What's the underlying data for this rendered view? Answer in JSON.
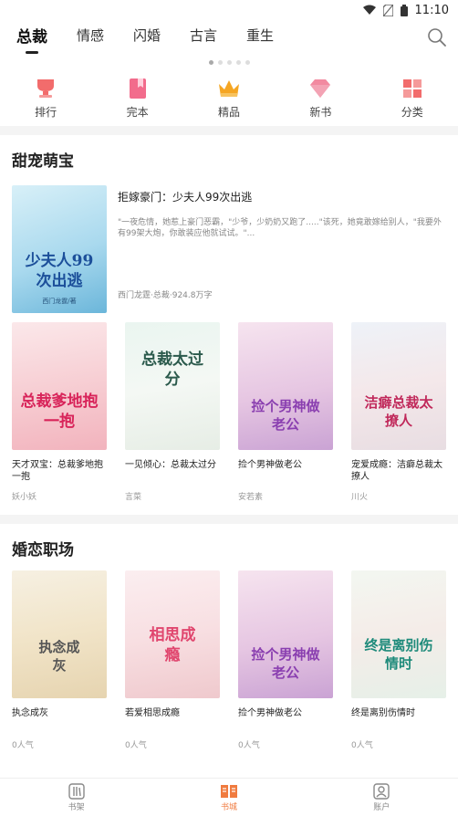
{
  "status_bar": {
    "time": "11:10"
  },
  "top_tabs": [
    "总裁",
    "情感",
    "闪婚",
    "古言",
    "重生"
  ],
  "categories": [
    "排行",
    "完本",
    "精品",
    "新书",
    "分类"
  ],
  "sections": [
    {
      "title": "甜宠萌宝",
      "featured": {
        "title": "拒嫁豪门：少夫人99次出逃",
        "description": "\"一夜危情，她惹上豪门恶霸，\"少爷，少奶奶又跑了.....\"该死，她竟敢嫁给别人，\"我要外有99架大炮，你敢装应他就试试。\"...",
        "meta": "西门龙霆·总裁·924.8万字",
        "cover_text": "少夫人99次出逃",
        "cover_author": "西门龙霆/著"
      },
      "books": [
        {
          "title": "天才双宝：总裁爹地抱一抱",
          "author": "妖小妖",
          "cover_text": "总裁爹地抱一抱"
        },
        {
          "title": "一见倾心：总裁太过分",
          "author": "言菜",
          "cover_text": "总裁太过分"
        },
        {
          "title": "捡个男神做老公",
          "author": "安若素",
          "cover_text": "捡个男神做老公"
        },
        {
          "title": "宠爱成瘾：洁癖总裁太撩人",
          "author": "川火",
          "cover_text": "洁癖总裁太撩人"
        }
      ]
    },
    {
      "title": "婚恋职场",
      "books": [
        {
          "title": "执念成灰",
          "author": "0人气",
          "cover_text": "执念成灰"
        },
        {
          "title": "若爱相思成瘾",
          "author": "0人气",
          "cover_text": "相思成瘾"
        },
        {
          "title": "捡个男神做老公",
          "author": "0人气",
          "cover_text": "捡个男神做老公"
        },
        {
          "title": "终是离别伤情时",
          "author": "0人气",
          "cover_text": "终是离别伤情时"
        }
      ]
    }
  ],
  "bottom_nav": [
    "书架",
    "书城",
    "账户"
  ],
  "colors": {
    "accent": "#f07b3f",
    "cat_icon": "#f26c6c",
    "crown": "#f5a623"
  }
}
